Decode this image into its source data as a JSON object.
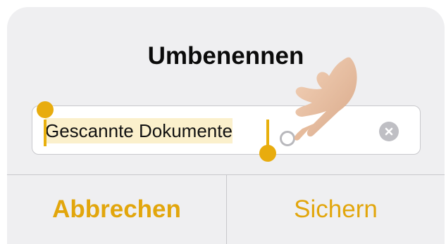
{
  "dialog": {
    "title": "Umbenennen",
    "field": {
      "value": "Gescannte Dokumente"
    },
    "buttons": {
      "cancel_label": "Abbrechen",
      "save_label": "Sichern"
    }
  },
  "colors": {
    "accent": "#e2a60c",
    "selection": "#fbf0cc",
    "dialog_bg": "#efeff1"
  },
  "icons": {
    "clear": "clear-icon",
    "hand": "pointing-hand-icon",
    "touch": "touch-indicator-icon"
  }
}
